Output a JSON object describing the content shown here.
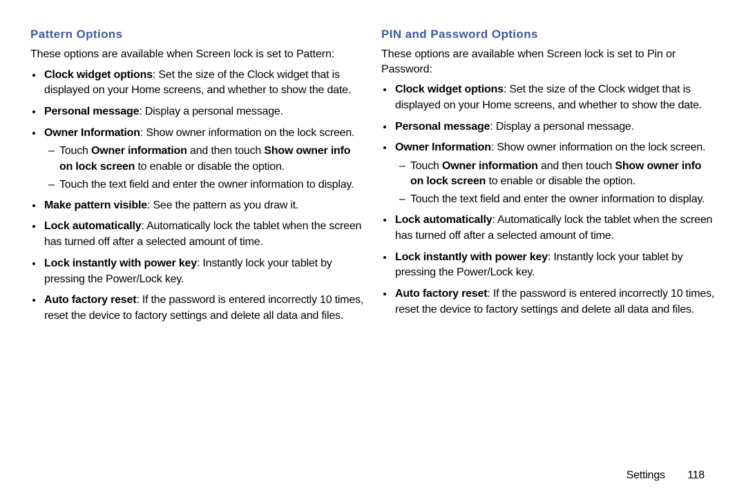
{
  "left": {
    "heading": "Pattern Options",
    "intro": "These options are available when Screen lock is set to Pattern:",
    "items": [
      {
        "bold": "Clock widget options",
        "rest": ": Set the size of the Clock widget that is displayed on your Home screens, and whether to show the date."
      },
      {
        "bold": "Personal message",
        "rest": ": Display a personal message."
      },
      {
        "bold": "Owner Information",
        "rest": ": Show owner information on the lock screen.",
        "nested": [
          {
            "pre": "Touch ",
            "b1": "Owner information",
            "mid": " and then touch ",
            "b2": "Show owner info on lock screen",
            "post": " to enable or disable the option."
          },
          {
            "text": "Touch the text field and enter the owner information to display."
          }
        ]
      },
      {
        "bold": "Make pattern visible",
        "rest": ": See the pattern as you draw it."
      },
      {
        "bold": "Lock automatically",
        "rest": ": Automatically lock the tablet when the screen has turned off after a selected amount of time."
      },
      {
        "bold": "Lock instantly with power key",
        "rest": ": Instantly lock your tablet by pressing the Power/Lock key."
      },
      {
        "bold": "Auto factory reset",
        "rest": ": If the password is entered incorrectly 10 times, reset the device to factory settings and delete all data and files."
      }
    ]
  },
  "right": {
    "heading": "PIN and Password Options",
    "intro": "These options are available when Screen lock is set to Pin or Password:",
    "items": [
      {
        "bold": "Clock widget options",
        "rest": ": Set the size of the Clock widget that is displayed on your Home screens, and whether to show the date."
      },
      {
        "bold": "Personal message",
        "rest": ": Display a personal message."
      },
      {
        "bold": "Owner Information",
        "rest": ": Show owner information on the lock screen.",
        "nested": [
          {
            "pre": "Touch ",
            "b1": "Owner information",
            "mid": " and then touch ",
            "b2": "Show owner info on lock screen",
            "post": " to enable or disable the option."
          },
          {
            "text": "Touch the text field and enter the owner information to display."
          }
        ]
      },
      {
        "bold": "Lock automatically",
        "rest": ": Automatically lock the tablet when the screen has turned off after a selected amount of time."
      },
      {
        "bold": "Lock instantly with power key",
        "rest": ": Instantly lock your tablet by pressing the Power/Lock key."
      },
      {
        "bold": "Auto factory reset",
        "rest": ": If the password is entered incorrectly 10 times, reset the device to factory settings and delete all data and files."
      }
    ]
  },
  "footer": {
    "section": "Settings",
    "page": "118"
  }
}
